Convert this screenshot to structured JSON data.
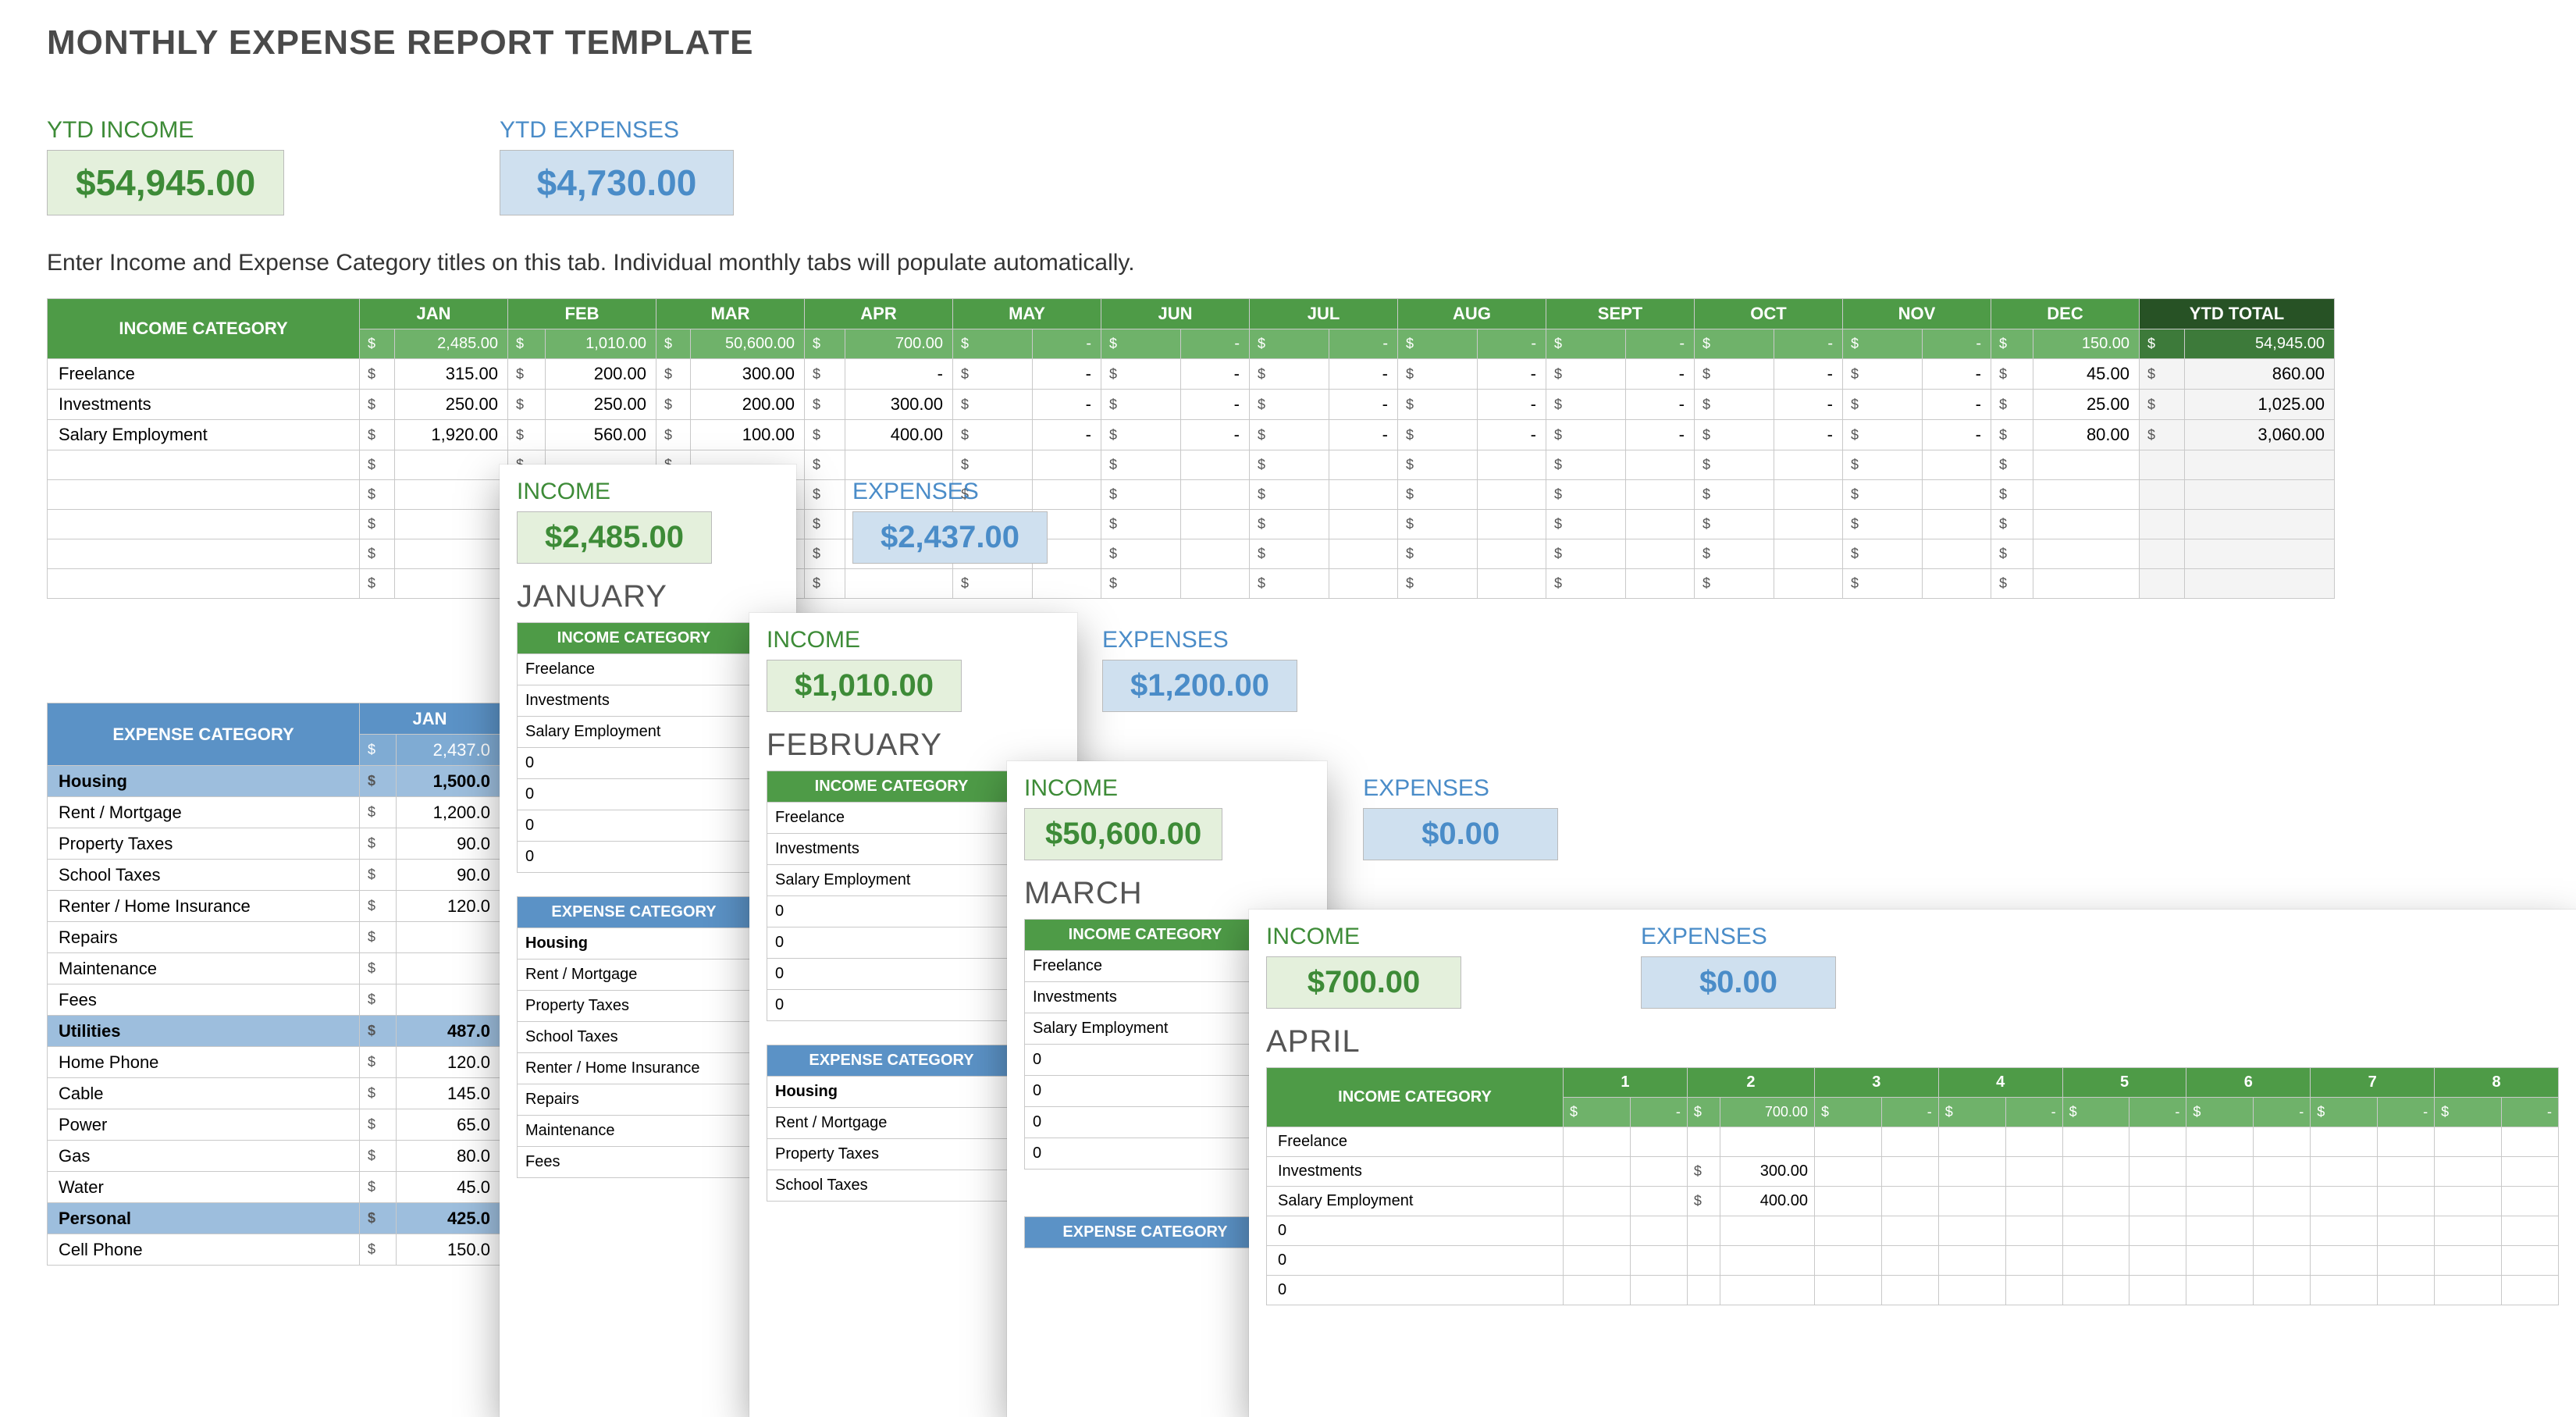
{
  "title": "MONTHLY EXPENSE REPORT TEMPLATE",
  "ytd": {
    "income_label": "YTD INCOME",
    "income_value": "$54,945.00",
    "expenses_label": "YTD EXPENSES",
    "expenses_value": "$4,730.00"
  },
  "instructions": "Enter Income and Expense Category titles on this tab.  Individual monthly tabs will populate automatically.",
  "months": [
    "JAN",
    "FEB",
    "MAR",
    "APR",
    "MAY",
    "JUN",
    "JUL",
    "AUG",
    "SEPT",
    "OCT",
    "NOV",
    "DEC"
  ],
  "ytd_total_label": "YTD TOTAL",
  "income_category_label": "INCOME CATEGORY",
  "expense_category_label": "EXPENSE CATEGORY",
  "income_sub": [
    "2,485.00",
    "1,010.00",
    "50,600.00",
    "700.00",
    "-",
    "-",
    "-",
    "-",
    "-",
    "-",
    "-",
    "150.00"
  ],
  "income_ytd_sub": "54,945.00",
  "income_rows": [
    {
      "label": "Freelance",
      "vals": [
        "315.00",
        "200.00",
        "300.00",
        "-",
        "-",
        "-",
        "-",
        "-",
        "-",
        "-",
        "-",
        "45.00"
      ],
      "ytd": "860.00"
    },
    {
      "label": "Investments",
      "vals": [
        "250.00",
        "250.00",
        "200.00",
        "300.00",
        "-",
        "-",
        "-",
        "-",
        "-",
        "-",
        "-",
        "25.00"
      ],
      "ytd": "1,025.00"
    },
    {
      "label": "Salary Employment",
      "vals": [
        "1,920.00",
        "560.00",
        "100.00",
        "400.00",
        "-",
        "-",
        "-",
        "-",
        "-",
        "-",
        "-",
        "80.00"
      ],
      "ytd": "3,060.00"
    }
  ],
  "expense_sub_jan": "2,437.0",
  "expense_rows": [
    {
      "label": "Housing",
      "val": "1,500.0",
      "group": true
    },
    {
      "label": "Rent / Mortgage",
      "val": "1,200.0"
    },
    {
      "label": "Property Taxes",
      "val": "90.0"
    },
    {
      "label": "School Taxes",
      "val": "90.0"
    },
    {
      "label": "Renter / Home Insurance",
      "val": "120.0"
    },
    {
      "label": "Repairs",
      "val": ""
    },
    {
      "label": "Maintenance",
      "val": ""
    },
    {
      "label": "Fees",
      "val": ""
    },
    {
      "label": "Utilities",
      "val": "487.0",
      "group": true
    },
    {
      "label": "Home Phone",
      "val": "120.0"
    },
    {
      "label": "Cable",
      "val": "145.0"
    },
    {
      "label": "Power",
      "val": "65.0"
    },
    {
      "label": "Gas",
      "val": "80.0"
    },
    {
      "label": "Water",
      "val": "45.0"
    },
    {
      "label": "Personal",
      "val": "425.0",
      "group": true
    },
    {
      "label": "Cell Phone",
      "val": "150.0"
    }
  ],
  "jan_panel": {
    "income_label": "INCOME",
    "income_value": "$2,485.00",
    "expenses_label": "EXPENSES",
    "expenses_value": "$2,437.00",
    "month": "JANUARY",
    "inc_rows": [
      "Freelance",
      "Investments",
      "Salary Employment",
      "0",
      "0",
      "0",
      "0"
    ],
    "exp_rows": [
      "Housing",
      "Rent / Mortgage",
      "Property Taxes",
      "School Taxes",
      "Renter / Home Insurance",
      "Repairs",
      "Maintenance",
      "Fees"
    ]
  },
  "feb_panel": {
    "income_label": "INCOME",
    "income_value": "$1,010.00",
    "expenses_label": "EXPENSES",
    "expenses_value": "$1,200.00",
    "month": "FEBRUARY",
    "inc_rows": [
      "Freelance",
      "Investments",
      "Salary Employment",
      "0",
      "0",
      "0",
      "0"
    ],
    "exp_rows": [
      "Housing",
      "Rent / Mortgage",
      "Property Taxes",
      "School Taxes"
    ]
  },
  "mar_panel": {
    "income_label": "INCOME",
    "income_value": "$50,600.00",
    "expenses_label": "EXPENSES",
    "expenses_value": "$0.00",
    "month": "MARCH",
    "inc_rows": [
      "Freelance",
      "Investments",
      "Salary Employment",
      "0",
      "0",
      "0",
      "0"
    ]
  },
  "apr_panel": {
    "income_label": "INCOME",
    "income_value": "$700.00",
    "expenses_label": "EXPENSES",
    "expenses_value": "$0.00",
    "month": "APRIL",
    "days": [
      "1",
      "2",
      "3",
      "4",
      "5",
      "6",
      "7",
      "8"
    ],
    "sub": [
      "-",
      "700.00",
      "-",
      "-",
      "-",
      "-",
      "-",
      "-"
    ],
    "rows": [
      {
        "label": "Freelance",
        "vals": [
          "",
          "",
          "",
          "",
          "",
          "",
          "",
          ""
        ]
      },
      {
        "label": "Investments",
        "vals": [
          "",
          "300.00",
          "",
          "",
          "",
          "",
          "",
          ""
        ]
      },
      {
        "label": "Salary Employment",
        "vals": [
          "",
          "400.00",
          "",
          "",
          "",
          "",
          "",
          ""
        ]
      },
      {
        "label": "0",
        "vals": [
          "",
          "",
          "",
          "",
          "",
          "",
          "",
          ""
        ]
      },
      {
        "label": "0",
        "vals": [
          "",
          "",
          "",
          "",
          "",
          "",
          "",
          ""
        ]
      },
      {
        "label": "0",
        "vals": [
          "",
          "",
          "",
          "",
          "",
          "",
          "",
          ""
        ]
      }
    ]
  }
}
